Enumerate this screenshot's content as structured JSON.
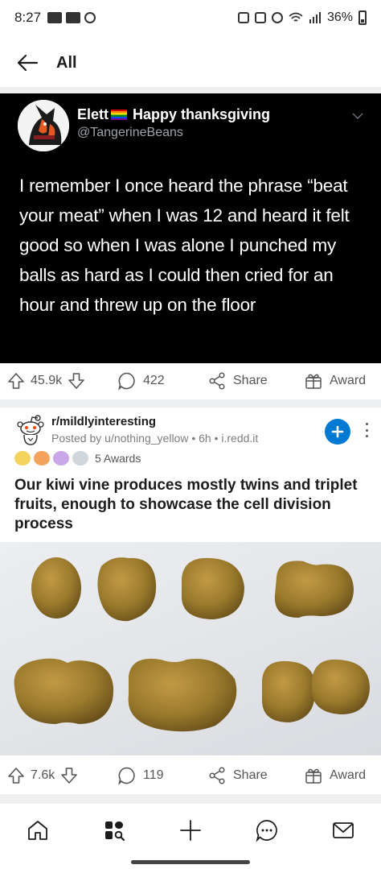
{
  "status_bar": {
    "time": "8:27",
    "battery": "36%"
  },
  "header": {
    "title": "All"
  },
  "post1": {
    "tweet": {
      "name": "Elett",
      "name_suffix": "Happy thanksgiving",
      "handle": "@TangerineBeans",
      "text": "I remember I once heard the phrase “beat your meat” when I was 12 and heard it felt good so when I was alone I punched my balls as hard as I could then cried for an hour and threw up on the floor"
    },
    "actions": {
      "votes": "45.9k",
      "comments": "422",
      "share": "Share",
      "award": "Award"
    }
  },
  "post2": {
    "subreddit": "r/mildlyinteresting",
    "posted_by": "Posted by u/nothing_yellow • 6h • i.redd.it",
    "awards": "5 Awards",
    "title": "Our kiwi vine produces mostly twins and triplet fruits, enough to showcase the cell division process",
    "actions": {
      "votes": "7.6k",
      "comments": "119",
      "share": "Share",
      "award": "Award"
    }
  },
  "colors": {
    "accent_blue": "#0079d3",
    "tweet_background": "#000000",
    "kiwi_skin": "#9a7a2c"
  },
  "bottom_nav": {
    "items": [
      "home-icon",
      "discover-icon",
      "create-post-icon",
      "chat-icon",
      "inbox-icon"
    ]
  }
}
